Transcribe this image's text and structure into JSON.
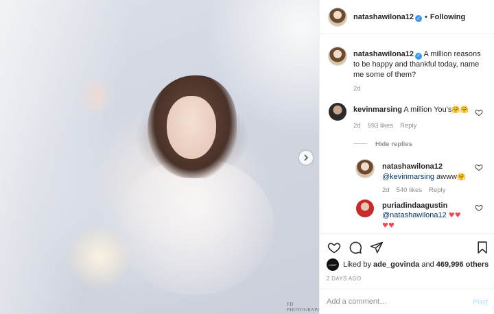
{
  "photo": {
    "watermark": "FD PHOTOGRAPHY",
    "next_icon": "chevron-right-icon"
  },
  "header": {
    "username": "natashawilona12",
    "separator": "•",
    "follow_label": "Following"
  },
  "caption": {
    "username": "natashawilona12",
    "text": "A million reasons to be happy and thankful today, name me some of them?",
    "age": "2d"
  },
  "comments": [
    {
      "username": "kevinmarsing",
      "text": "A million You's",
      "emoji": "🤗🤗",
      "age": "2d",
      "likes": "593 likes",
      "reply_label": "Reply"
    }
  ],
  "hide_replies_label": "Hide replies",
  "replies": [
    {
      "username": "natashawilona12",
      "mention": "@kevinmarsing",
      "text": "awww",
      "emoji": "🤗",
      "age": "2d",
      "likes": "540 likes",
      "reply_label": "Reply"
    },
    {
      "username": "puriadindaagustin",
      "mention": "@natashawilona12",
      "hearts_line1": "♥♥",
      "hearts_line2": "♥♥"
    }
  ],
  "likes_line": {
    "prefix": "Liked by",
    "liker": "ade_govinda",
    "middle": "and",
    "count": "469,996 others",
    "liker_avatar_text": "LIGHT"
  },
  "time_ago": "2 DAYS AGO",
  "add_comment": {
    "placeholder": "Add a comment…",
    "post_label": "Post"
  },
  "colors": {
    "link_blue": "#003569",
    "verified_blue": "#3897f0",
    "heart_red": "#ed4956",
    "muted_gray": "#8e8e8e",
    "post_disabled": "#b2dffc"
  }
}
